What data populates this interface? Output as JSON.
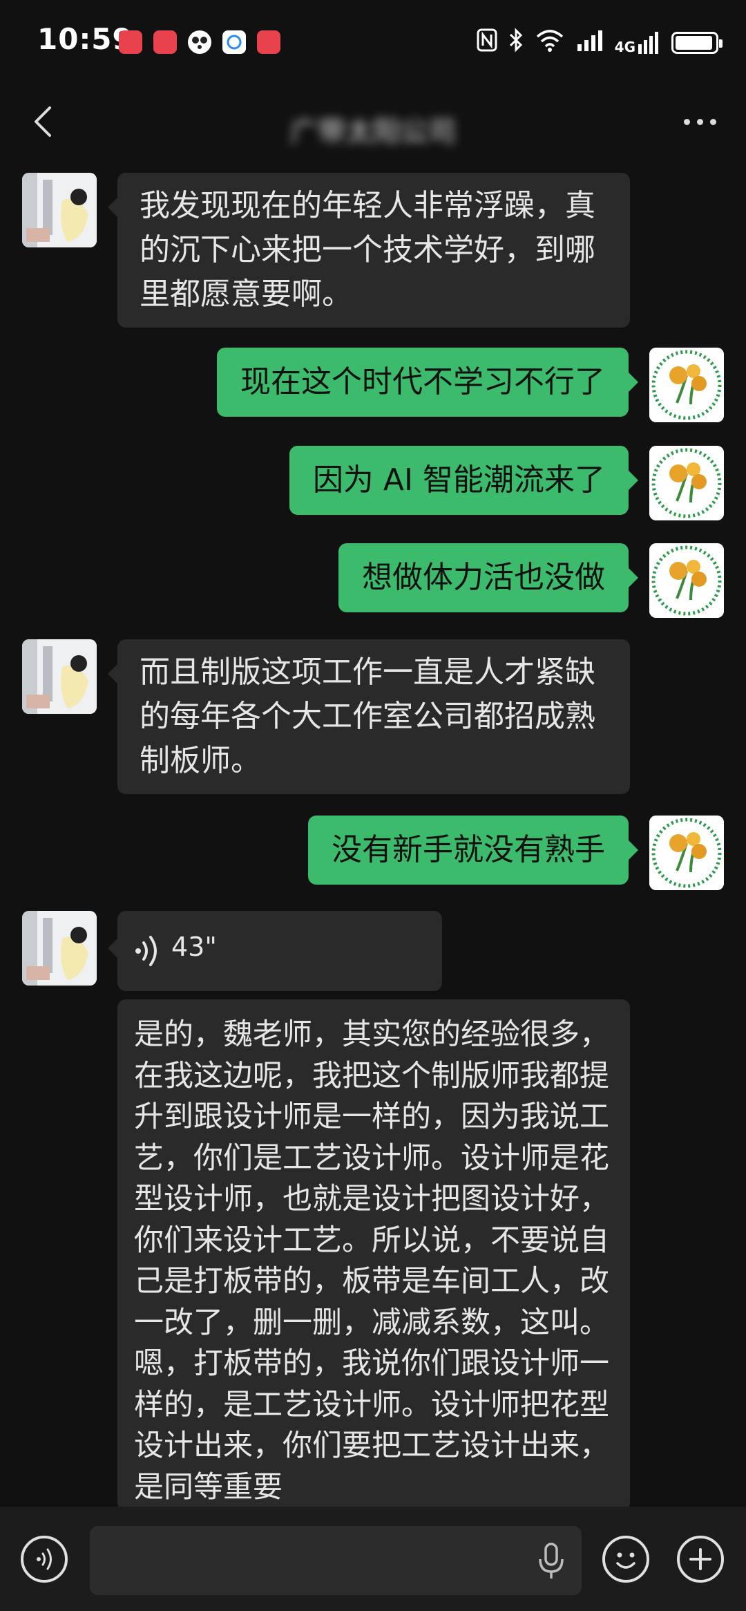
{
  "status_bar": {
    "time": "10:59",
    "notification_icons": [
      {
        "icon": "huawei-app-icon",
        "color": "#e8424d"
      },
      {
        "icon": "huawei-app-icon",
        "color": "#e8424d"
      },
      {
        "icon": "panda-app-icon",
        "color": "#ffffff"
      },
      {
        "icon": "chat-app-icon",
        "color": "#ffffff"
      },
      {
        "icon": "huawei-app-icon",
        "color": "#e8424d"
      }
    ],
    "network_label": "4G",
    "battery_level": 0.95
  },
  "header": {
    "title": "广带太阳公司",
    "back_icon": "chevron-left-icon",
    "more_icon": "more-dots-icon"
  },
  "messages": [
    {
      "side": "left",
      "type": "text",
      "text": "我发现现在的年轻人非常浮躁，真的沉下心来把一个技术学好，到哪里都愿意要啊。"
    },
    {
      "side": "right",
      "type": "text",
      "text": "现在这个时代不学习不行了"
    },
    {
      "side": "right",
      "type": "text",
      "text": "因为 AI 智能潮流来了"
    },
    {
      "side": "right",
      "type": "text",
      "text": "想做体力活也没做"
    },
    {
      "side": "left",
      "type": "text",
      "text": "而且制版这项工作一直是人才紧缺的每年各个大工作室公司都招成熟制板师。"
    },
    {
      "side": "right",
      "type": "text",
      "text": "没有新手就没有熟手"
    },
    {
      "side": "left",
      "type": "voice",
      "duration": "43\""
    },
    {
      "side": "left",
      "type": "transcript",
      "text": "是的，魏老师，其实您的经验很多，在我这边呢，我把这个制版师我都提升到跟设计师是一样的，因为我说工艺，你们是工艺设计师。设计师是花型设计师，也就是设计把图设计好，你们来设计工艺。所以说，不要说自己是打板带的，板带是车间工人，改一改了，删一删，减减系数，这叫。嗯，打板带的，我说你们跟设计师一样的，是工艺设计师。设计师把花型设计出来，你们要把工艺设计出来，是同等重要"
    }
  ],
  "colors": {
    "background": "#111111",
    "bubble_left": "#2a2a2a",
    "bubble_right": "#3dbb6c"
  },
  "input_bar": {
    "voice_icon": "voice-toggle-icon",
    "mic_icon": "microphone-icon",
    "emoji_icon": "emoji-icon",
    "plus_icon": "plus-icon"
  }
}
